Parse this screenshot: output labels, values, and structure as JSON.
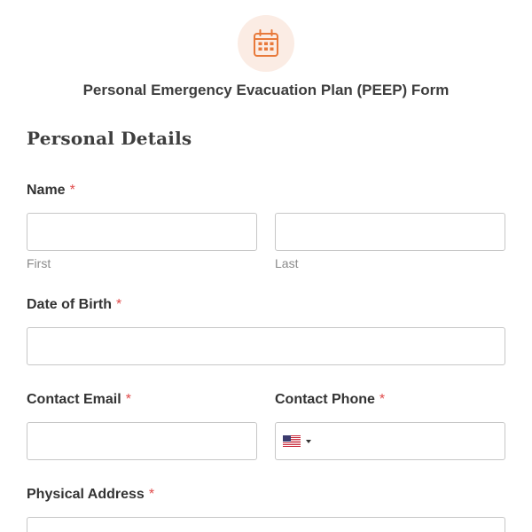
{
  "form": {
    "icon": "calendar-icon",
    "title": "Personal Emergency Evacuation Plan (PEEP) Form",
    "accent_color": "#e8793a",
    "required_marker": "*"
  },
  "section": {
    "title": "Personal Details"
  },
  "fields": {
    "name": {
      "label": "Name",
      "first": {
        "value": "",
        "sublabel": "First"
      },
      "last": {
        "value": "",
        "sublabel": "Last"
      }
    },
    "dob": {
      "label": "Date of Birth",
      "value": ""
    },
    "email": {
      "label": "Contact Email",
      "value": ""
    },
    "phone": {
      "label": "Contact Phone",
      "value": "",
      "country_flag": "us-flag-icon"
    },
    "address": {
      "label": "Physical Address",
      "value": ""
    }
  }
}
